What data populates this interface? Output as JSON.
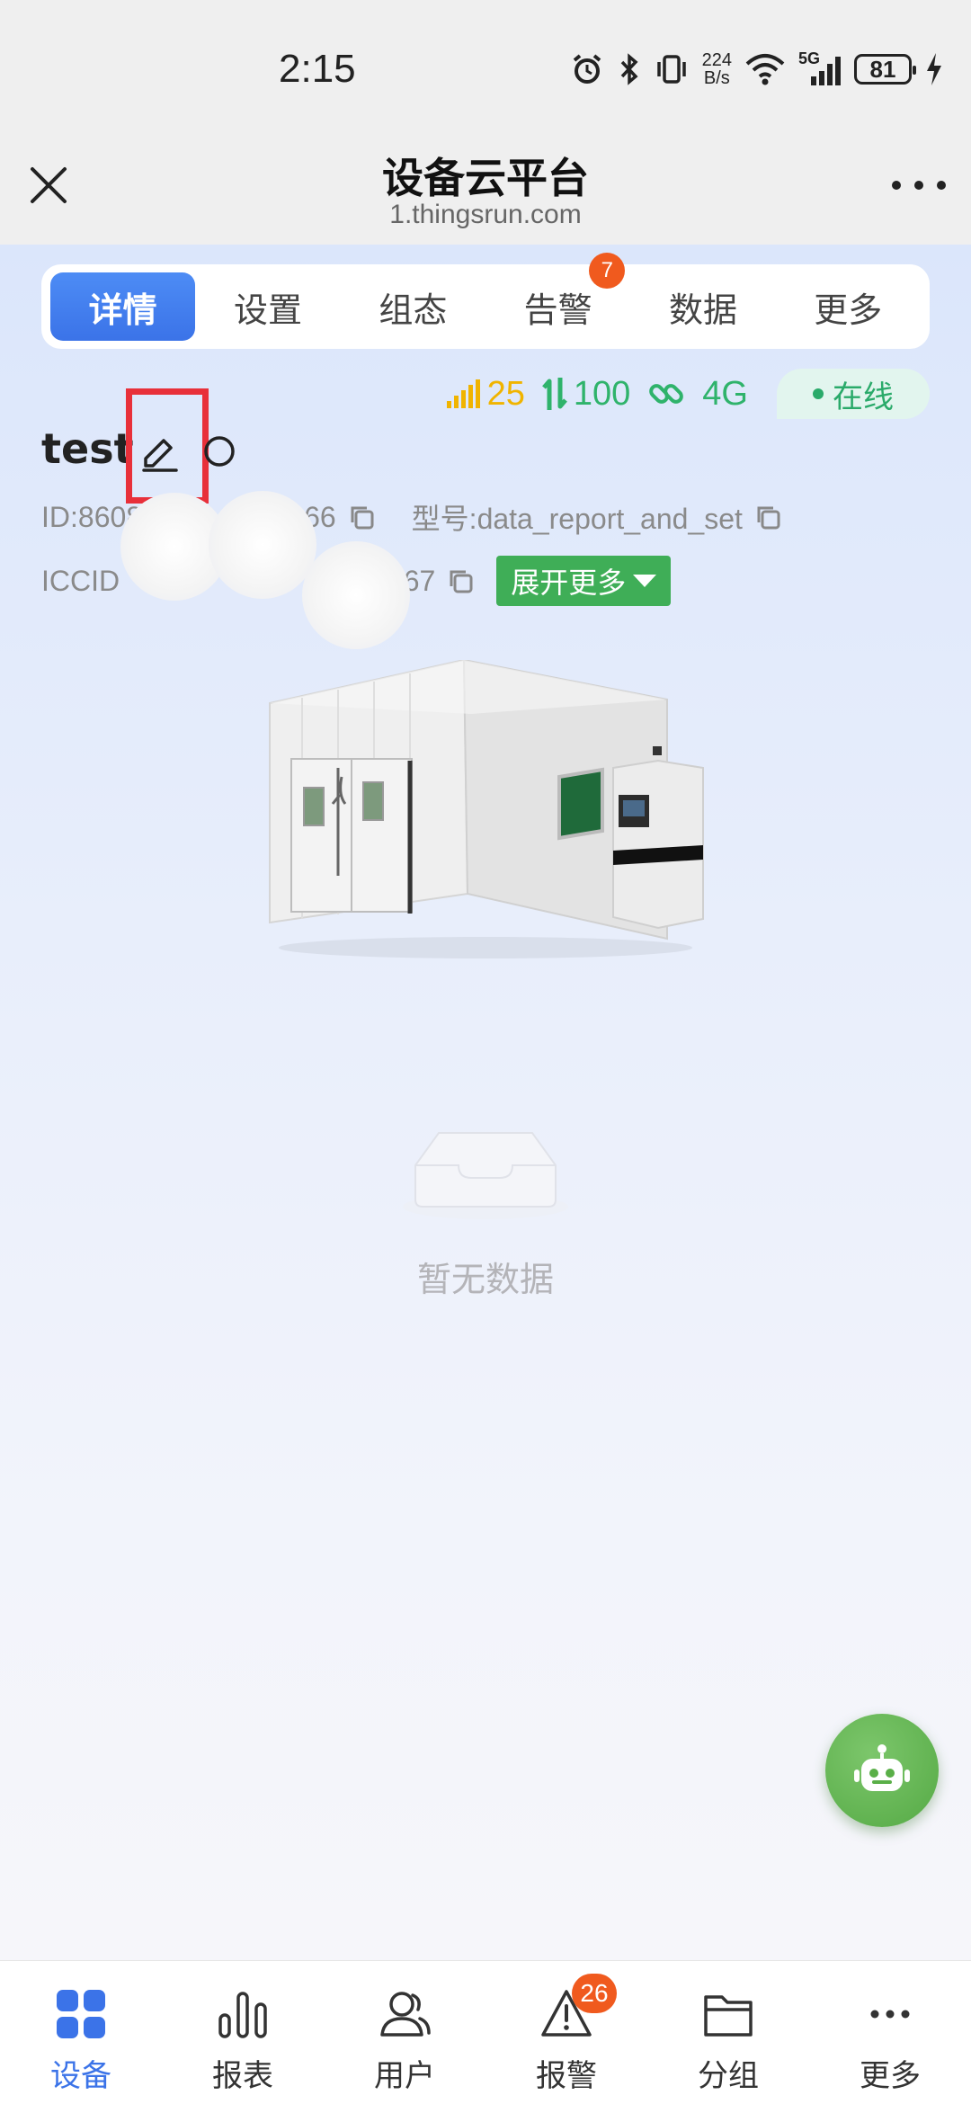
{
  "status_bar": {
    "time": "2:15",
    "net_speed_value": "224",
    "net_speed_unit": "B/s",
    "network_label": "5G",
    "battery": "81"
  },
  "header": {
    "title": "设备云平台",
    "url": "1.thingsrun.com"
  },
  "tabs": [
    {
      "label": "详情",
      "active": true
    },
    {
      "label": "设置"
    },
    {
      "label": "组态"
    },
    {
      "label": "告警",
      "badge": "7"
    },
    {
      "label": "数据"
    },
    {
      "label": "更多"
    }
  ],
  "device_stats": {
    "signal": "25",
    "flow": "100",
    "network": "4G",
    "status": "在线"
  },
  "device": {
    "name": "test",
    "id_prefix": "ID:8608",
    "id_suffix": "66",
    "model": "型号:data_report_and_set",
    "iccid_prefix": "ICCID",
    "iccid_suffix": "4067",
    "expand_label": "展开更多"
  },
  "empty_state": {
    "text": "暂无数据"
  },
  "bottom_nav": [
    {
      "label": "设备",
      "icon": "grid-icon",
      "active": true
    },
    {
      "label": "报表",
      "icon": "bar-chart-icon"
    },
    {
      "label": "用户",
      "icon": "users-icon"
    },
    {
      "label": "报警",
      "icon": "warning-icon",
      "badge": "26"
    },
    {
      "label": "分组",
      "icon": "folder-icon"
    },
    {
      "label": "更多",
      "icon": "more-dots-icon"
    }
  ],
  "colors": {
    "accent": "#3b73e8",
    "highlight": "#e8303a",
    "online": "#2aaa6a",
    "signal": "#f0b400",
    "badge": "#f05a1e",
    "expand_button": "#3fae57"
  }
}
